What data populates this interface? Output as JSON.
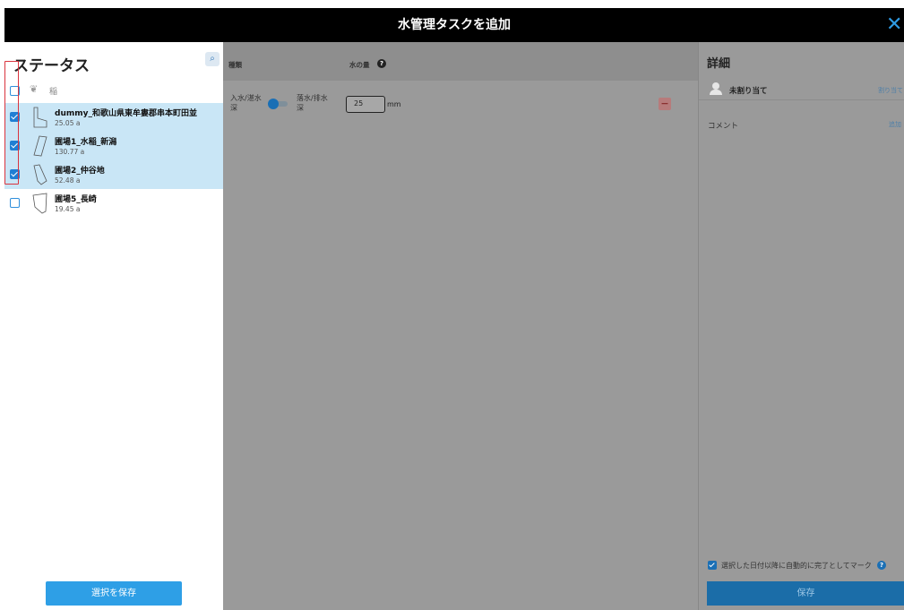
{
  "header": {
    "title": "水管理タスクを追加",
    "close_label": "✕"
  },
  "left_panel": {
    "title": "ステータス",
    "search_icon": "🔍",
    "crop_label": "稲",
    "fields": [
      {
        "name": "dummy_和歌山県東牟婁郡串本町田並",
        "area": "25.05 a",
        "checked": true
      },
      {
        "name": "圃場1_水稲_新潟",
        "area": "130.77 a",
        "checked": true
      },
      {
        "name": "圃場2_仲谷地",
        "area": "52.48 a",
        "checked": true
      },
      {
        "name": "圃場5_長崎",
        "area": "19.45 a",
        "checked": false
      }
    ],
    "save_label": "選択を保存"
  },
  "middle_panel": {
    "kind_header": "種類",
    "amount_header": "水の量",
    "help_icon": "?",
    "inlet_label": "入水/湛水深",
    "outlet_label": "落水/排水深",
    "amount_value": "25",
    "unit": "mm",
    "remove_icon": "−"
  },
  "right_panel": {
    "title": "詳細",
    "assignee": "未割り当て",
    "assign_link": "割り当て",
    "comment_label": "コメント",
    "add_link": "追加",
    "auto_complete_label": "選択した日付以降に自動的に完了としてマーク",
    "help_icon": "?",
    "save_label": "保存"
  },
  "colors": {
    "accent": "#2e9fe6",
    "selected_row": "#c9e6f6",
    "highlight_box": "#d9343e"
  }
}
